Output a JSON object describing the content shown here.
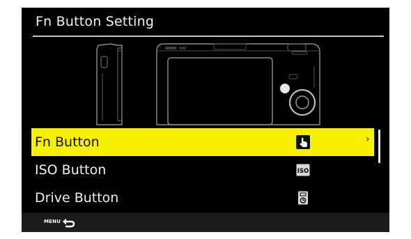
{
  "screen": {
    "title": "Fn Button Setting"
  },
  "menu": {
    "items": [
      {
        "label": "Fn Button",
        "icon": "hand-pointer-icon",
        "selected": true,
        "indicator": "›"
      },
      {
        "label": "ISO Button",
        "icon": "iso-icon",
        "selected": false,
        "icon_text": "ISO"
      },
      {
        "label": "Drive Button",
        "icon": "drive-mode-icon",
        "selected": false
      }
    ]
  },
  "footer": {
    "menu_key": "MENU",
    "back_icon": "return-arrow-icon"
  },
  "colors": {
    "highlight": "#f7f200",
    "background": "#000000",
    "text": "#f0f0f0"
  }
}
